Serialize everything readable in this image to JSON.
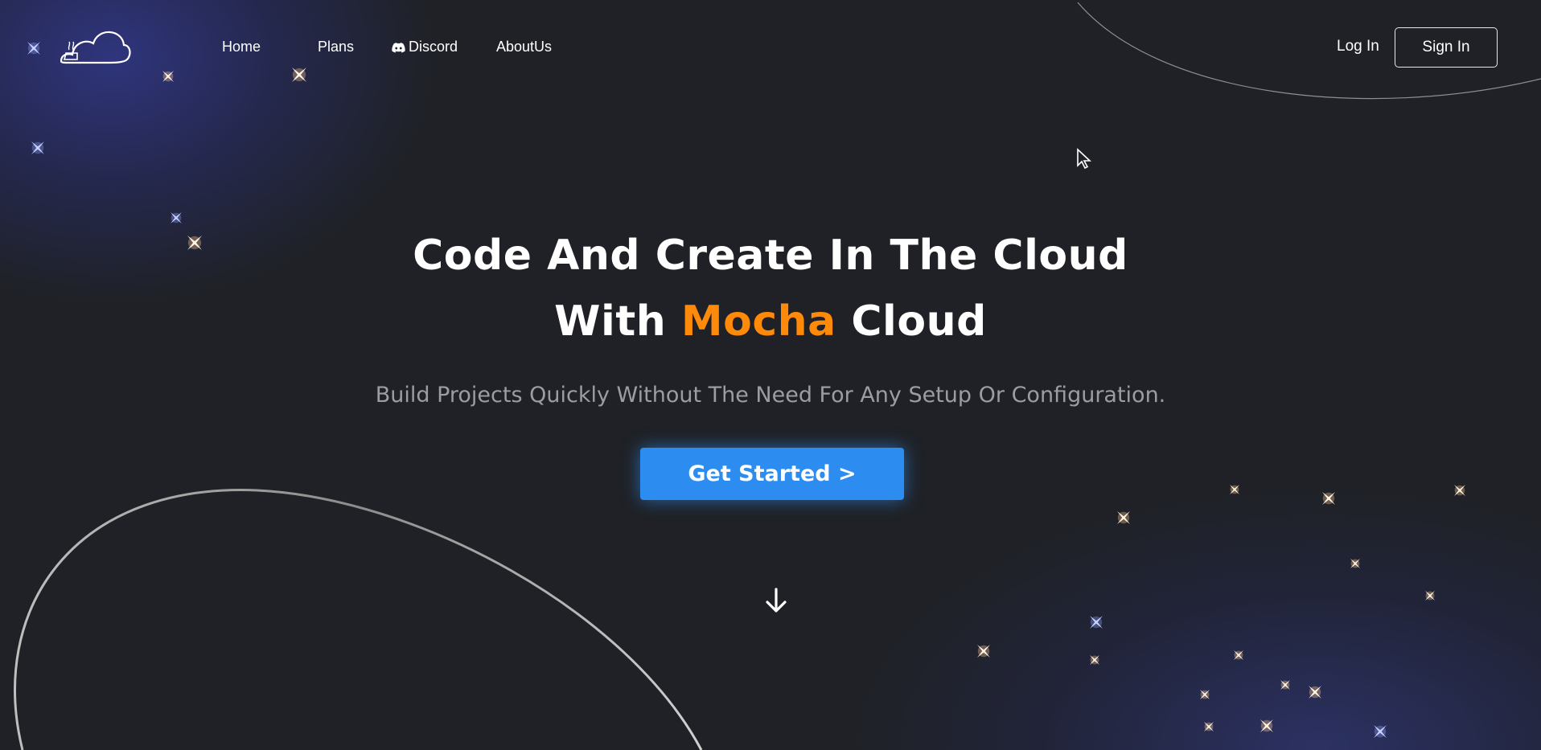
{
  "nav": {
    "home": "Home",
    "plans": "Plans",
    "discord": "Discord",
    "about": "AboutUs",
    "login": "Log In",
    "signin": "Sign In"
  },
  "hero": {
    "line1": "Code And Create In The Cloud",
    "line2_prefix": "With ",
    "line2_accent": "Mocha",
    "line2_suffix": " Cloud",
    "subtitle": "Build Projects Quickly Without The Need For Any Setup Or Configuration.",
    "cta": "Get Started >"
  },
  "colors": {
    "background": "#1f2126",
    "accent": "#ff8a0a",
    "cta": "#2d8cf0"
  },
  "icons": [
    "cloud-logo-icon",
    "discord-icon",
    "arrow-down-icon",
    "sparkle-star-icon",
    "mouse-cursor-icon"
  ]
}
